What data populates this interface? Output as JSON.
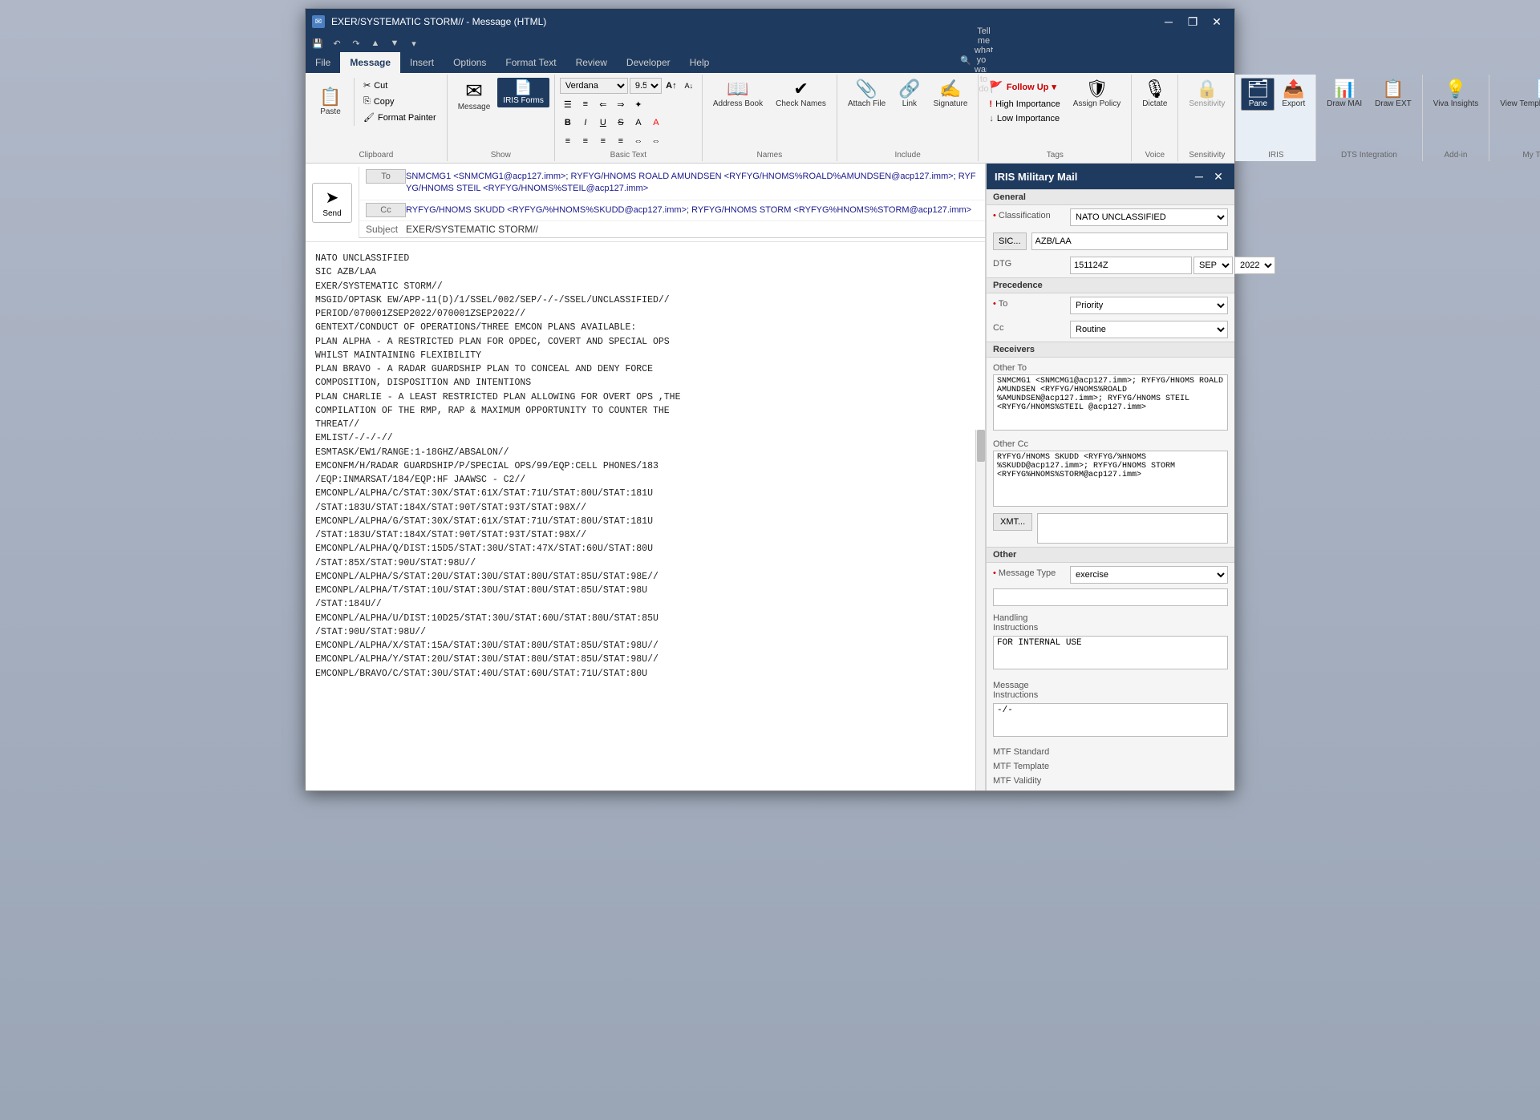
{
  "window": {
    "title": "EXER/SYSTEMATIC STORM// - Message (HTML)",
    "titlebar_icon": "✉"
  },
  "titlebar_controls": {
    "minimize": "─",
    "restore": "❐",
    "close": "✕"
  },
  "qat": {
    "save": "💾",
    "undo": "↶",
    "redo": "↷",
    "up": "▲",
    "down": "▼",
    "more": "▾"
  },
  "ribbon": {
    "tabs": [
      "File",
      "Message",
      "Insert",
      "Options",
      "Format Text",
      "Review",
      "Developer",
      "Help"
    ],
    "active_tab": "Message",
    "groups": {
      "clipboard": {
        "label": "Clipboard",
        "paste_label": "Paste",
        "cut_label": "Cut",
        "copy_label": "Copy",
        "format_painter_label": "Format Painter"
      },
      "show": {
        "label": "Show",
        "message_label": "Message",
        "iris_forms_label": "IRIS Forms"
      },
      "basic_text": {
        "label": "Basic Text",
        "font": "Verdana",
        "font_size": "9.5",
        "grow": "A",
        "shrink": "a",
        "bold": "B",
        "italic": "I",
        "underline": "U",
        "strikethrough": "S"
      },
      "names": {
        "label": "Names",
        "address_book": "Address Book",
        "check_names": "Check Names"
      },
      "include": {
        "label": "Include",
        "attach_file": "Attach File",
        "link": "Link",
        "signature": "Signature"
      },
      "tags": {
        "label": "Tags",
        "follow_up": "Follow Up",
        "high_importance": "High Importance",
        "low_importance": "Low Importance",
        "assign_policy": "Assign Policy"
      },
      "voice": {
        "label": "Voice",
        "dictate": "Dictate"
      },
      "sensitivity": {
        "label": "Sensitivity",
        "sensitivity": "Sensitivity"
      },
      "iris": {
        "label": "IRIS",
        "pane": "Pane",
        "export": "Export"
      },
      "dts_integration": {
        "label": "DTS Integration",
        "draw_mai": "Draw MAI",
        "draw_ext": "Draw EXT"
      },
      "add_in": {
        "label": "Add-in",
        "viva_insights": "Viva Insights"
      },
      "my_templates": {
        "label": "My Templates",
        "view_templates": "View Templates Templates"
      }
    }
  },
  "email": {
    "to": "SNMCMG1 <SNMCMG1@acp127.imm>; RYFYG/HNOMS ROALD AMUNDSEN <RYFYG/HNOMS%ROALD%AMUNDSEN@acp127.imm>; RYFYG/HNOMS STEIL <RYFYG/HNOMS%STEIL@acp127.imm>",
    "cc": "RYFYG/HNOMS SKUDD <RYFYG/%HNOMS%SKUDD@acp127.imm>; RYFYG/HNOMS STORM <RYFYG%HNOMS%STORM@acp127.imm>",
    "subject": "EXER/SYSTEMATIC STORM//",
    "body": "NATO UNCLASSIFIED\nSIC AZB/LAA\nEXER/SYSTEMATIC STORM//\nMSGID/OPTASK EW/APP-11(D)/1/SSEL/002/SEP/-/-/SSEL/UNCLASSIFIED//\nPERIOD/070001ZSEP2022/070001ZSEP2022//\nGENTEXT/CONDUCT OF OPERATIONS/THREE EMCON PLANS AVAILABLE:\nPLAN ALPHA - A RESTRICTED PLAN FOR OPDEC, COVERT AND SPECIAL OPS\nWHILST MAINTAINING FLEXIBILITY\nPLAN BRAVO - A RADAR GUARDSHIP PLAN TO CONCEAL AND DENY FORCE\nCOMPOSITION, DISPOSITION AND INTENTIONS\nPLAN CHARLIE - A LEAST RESTRICTED PLAN ALLOWING FOR OVERT OPS ,THE\nCOMPILATION OF THE RMP, RAP & MAXIMUM OPPORTUNITY TO COUNTER THE\nTHREAT//\nEMLIST/-/-/-//\nESMTASK/EW1/RANGE:1-18GHZ/ABSALON//\nEMCONFM/H/RADAR GUARDSHIP/P/SPECIAL OPS/99/EQP:CELL PHONES/183\n/EQP:INMARSAT/184/EQP:HF JAAWSC - C2//\nEMCONPL/ALPHA/C/STAT:30X/STAT:61X/STAT:71U/STAT:80U/STAT:181U\n/STAT:183U/STAT:184X/STAT:90T/STAT:93T/STAT:98X//\nEMCONPL/ALPHA/G/STAT:30X/STAT:61X/STAT:71U/STAT:80U/STAT:181U\n/STAT:183U/STAT:184X/STAT:90T/STAT:93T/STAT:98X//\nEMCONPL/ALPHA/Q/DIST:15D5/STAT:30U/STAT:47X/STAT:60U/STAT:80U\n/STAT:85X/STAT:90U/STAT:98U//\nEMCONPL/ALPHA/S/STAT:20U/STAT:30U/STAT:80U/STAT:85U/STAT:98E//\nEMCONPL/ALPHA/T/STAT:10U/STAT:30U/STAT:80U/STAT:85U/STAT:98U\n/STAT:184U//\nEMCONPL/ALPHA/U/DIST:10D25/STAT:30U/STAT:60U/STAT:80U/STAT:85U\n/STAT:90U/STAT:98U//\nEMCONPL/ALPHA/X/STAT:15A/STAT:30U/STAT:80U/STAT:85U/STAT:98U//\nEMCONPL/ALPHA/Y/STAT:20U/STAT:30U/STAT:80U/STAT:85U/STAT:98U//\nEMCONPL/BRAVO/C/STAT:30U/STAT:40U/STAT:60U/STAT:71U/STAT:80U"
  },
  "iris_panel": {
    "title": "IRIS Military Mail",
    "sections": {
      "general": {
        "title": "General",
        "classification_label": "Classification",
        "classification_value": "NATO UNCLASSIFIED",
        "sic_label": "SIC...",
        "sic_value": "AZB/LAA",
        "dtg_label": "DTG",
        "dtg_value": "151124Z",
        "dtg_month": "SEP",
        "dtg_year": "2022"
      },
      "precedence": {
        "title": "Precedence",
        "to_label": "To",
        "to_value": "Priority",
        "cc_label": "Cc",
        "cc_value": "Routine"
      },
      "receivers": {
        "title": "Receivers",
        "other_to_label": "Other To",
        "other_to_value": "SNMCMG1 <SNMCMG1@acp127.imm>; RYFYG/HNOMS ROALD AMUNDSEN <RYFYG/HNOMS%ROALD %AMUNDSEN@acp127.imm>; RYFYG/HNOMS STEIL <RYFYG/HNOMS%STEIL @acp127.imm>",
        "other_cc_label": "Other Cc",
        "other_cc_value": "RYFYG/HNOMS SKUDD <RYFYG/%HNOMS %SKUDD@acp127.imm>; RYFYG/HNOMS STORM <RYFYG%HNOMS%STORM@acp127.imm>",
        "xmt_label": "XMT...",
        "xmt_value": ""
      },
      "other": {
        "title": "Other",
        "message_type_label": "Message Type",
        "message_type_value": "exercise",
        "handling_instructions_label": "Handling Instructions",
        "handling_instructions_value": "FOR INTERNAL USE",
        "message_instructions_label": "Message Instructions",
        "message_instructions_value": "-/-"
      },
      "bottom": {
        "mtf_standard_label": "MTF Standard",
        "mtf_template_label": "MTF Template",
        "mtf_validity_label": "MTF Validity"
      }
    }
  }
}
